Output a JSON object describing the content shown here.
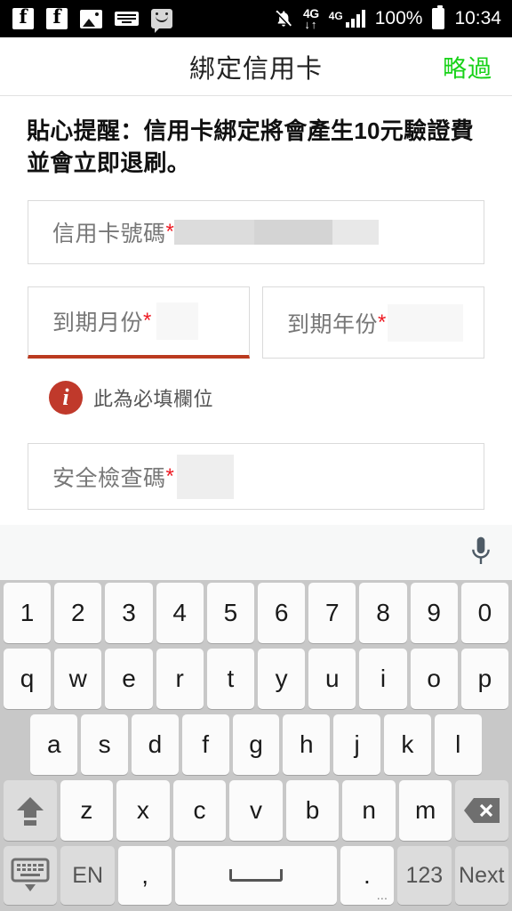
{
  "status_bar": {
    "left_icons": [
      "facebook-icon",
      "facebook-icon",
      "photo-icon",
      "keyboard-icon",
      "messenger-smiley-icon"
    ],
    "notifications_silenced_icon": "bell-off-icon",
    "data_network": "4G",
    "signal_network": "4G",
    "battery_percent": "100%",
    "time": "10:34"
  },
  "header": {
    "title": "綁定信用卡",
    "skip_label": "略過",
    "skip_color": "#18d218"
  },
  "notice": {
    "text": "貼心提醒：信用卡綁定將會產生10元驗證費並會立即退刷。"
  },
  "form": {
    "required_mark": "*",
    "fields": [
      {
        "name": "card-number",
        "label": "信用卡號碼",
        "value": "",
        "redacted": true
      },
      {
        "name": "expiry-month",
        "label": "到期月份",
        "value": "",
        "error": true
      },
      {
        "name": "expiry-year",
        "label": "到期年份",
        "value": ""
      },
      {
        "name": "security-code",
        "label": "安全檢查碼",
        "value": ""
      }
    ],
    "error": {
      "icon": "info-icon",
      "message": "此為必填欄位",
      "color": "#c0392b"
    }
  },
  "keyboard": {
    "mic_icon": "microphone-icon",
    "row_numbers": [
      "1",
      "2",
      "3",
      "4",
      "5",
      "6",
      "7",
      "8",
      "9",
      "0"
    ],
    "row_top": [
      "q",
      "w",
      "e",
      "r",
      "t",
      "y",
      "u",
      "i",
      "o",
      "p"
    ],
    "row_home": [
      "a",
      "s",
      "d",
      "f",
      "g",
      "h",
      "j",
      "k",
      "l"
    ],
    "row_bottom": [
      "z",
      "x",
      "c",
      "v",
      "b",
      "n",
      "m"
    ],
    "shift_label": "",
    "backspace_label": "",
    "hide_keyboard_label": "",
    "language_label": "EN",
    "comma_label": ",",
    "space_label": "",
    "period_label": ".",
    "period_sub": "...",
    "numeric_label": "123",
    "action_label": "Next"
  }
}
